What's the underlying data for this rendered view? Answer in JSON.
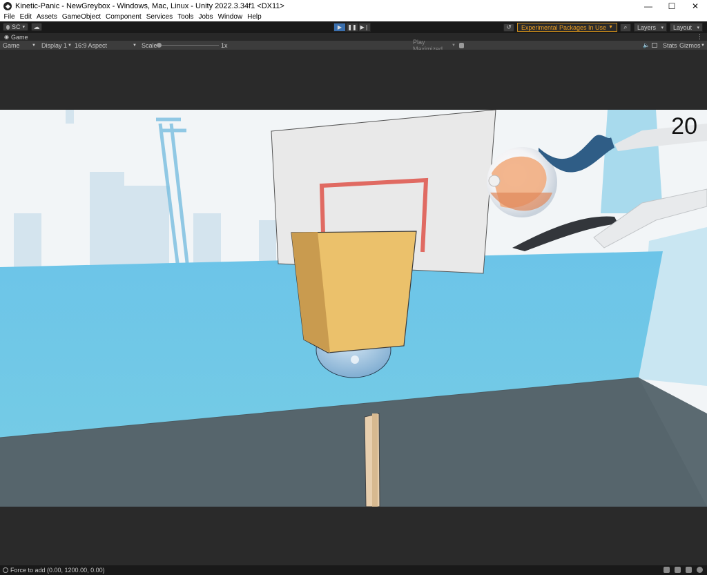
{
  "window": {
    "title": "Kinetic-Panic - NewGreybox - Windows, Mac, Linux - Unity 2022.3.34f1 <DX11>",
    "minimize": "—",
    "maximize": "☐",
    "close": "✕"
  },
  "menu": [
    "File",
    "Edit",
    "Assets",
    "GameObject",
    "Component",
    "Services",
    "Tools",
    "Jobs",
    "Window",
    "Help"
  ],
  "toolbar": {
    "account": "SC",
    "experimental": "Experimental Packages In Use",
    "layers": "Layers",
    "layout": "Layout"
  },
  "game_tab": {
    "label": "Game"
  },
  "game_bar": {
    "mode": "Game",
    "display": "Display 1",
    "aspect": "16:9 Aspect",
    "scale_label": "Scale",
    "scale_value": "1x",
    "play_mode": "Play Maximized",
    "stats": "Stats",
    "gizmos": "Gizmos"
  },
  "hud": {
    "score": "20"
  },
  "status": {
    "message": "Force to add (0.00, 1200.00, 0.00)"
  },
  "colors": {
    "sky": "#f2f5f7",
    "wall": "#6fc4e6",
    "floor": "#55646b",
    "cup": "#e8bd68",
    "board": "#e9e9e9",
    "rim": "#e06a62",
    "accent": "#3a6fae"
  }
}
